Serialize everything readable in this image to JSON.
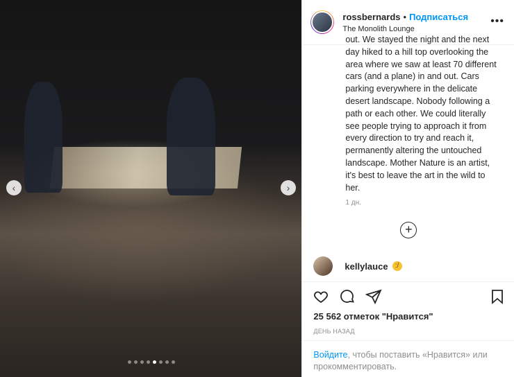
{
  "header": {
    "username": "rossbernards",
    "separator": "•",
    "follow_label": "Подписаться",
    "location": "The Monolith Lounge",
    "more_icon": "more-horizontal-icon"
  },
  "caption": {
    "text": "out. We stayed the night and the next day hiked to a hill top overlooking the area where we saw at least 70 different cars (and a plane) in and out. Cars parking everywhere in the delicate desert landscape. Nobody following a path or each other. We could literally see people trying to approach it from every direction to try and reach it, permanently altering the untouched landscape. Mother Nature is an artist, it's best to leave the art in the wild to her.",
    "time_ago": "1 дн.",
    "load_more_icon": "plus-circle-icon"
  },
  "comment": {
    "username": "kellylauce",
    "emoji": "😕"
  },
  "carousel": {
    "prev_icon": "chevron-left-icon",
    "next_icon": "chevron-right-icon",
    "dots_total": 8,
    "active_dot": 5
  },
  "actions": {
    "like_icon": "heart-icon",
    "comment_icon": "comment-icon",
    "share_icon": "share-icon",
    "save_icon": "bookmark-icon"
  },
  "likes_text": "25 562 отметок \"Нравится\"",
  "date_text": "ДЕНЬ НАЗАД",
  "login_prompt": {
    "link_text": "Войдите",
    "rest_text": ", чтобы поставить «Нравится» или прокомментировать."
  },
  "colors": {
    "accent": "#0095f6",
    "text": "#262626",
    "muted": "#8e8e8e",
    "divider": "#efefef"
  }
}
